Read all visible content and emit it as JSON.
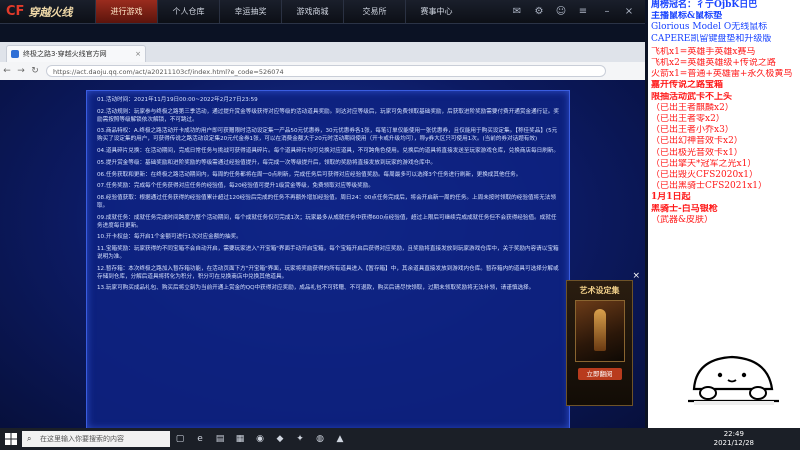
{
  "launcher": {
    "logo_text": "穿越火线",
    "tabs": [
      {
        "label": "进行游戏",
        "active": true
      },
      {
        "label": "个人仓库",
        "active": false
      },
      {
        "label": "幸运抽奖",
        "active": false
      },
      {
        "label": "游戏商城",
        "active": false
      },
      {
        "label": "交易所",
        "active": false
      },
      {
        "label": "赛事中心",
        "active": false
      }
    ]
  },
  "browser": {
    "tab_title": "终极之路3·穿越火线官方网",
    "url": "https://act.daoju.qq.com/act/a20211103cf/index.html?e_code=526074"
  },
  "notice": {
    "paragraphs": [
      "01.活动时间：2021年11月19日00:00~2022年2月27日23:59",
      "02.活动规则：玩家参与终极之路第三季活动，通过提升赏金等级获得对应等级的活动道具奖励。到达对应等级后，玩家可免费领取基础奖励，后获取进阶奖励需要付费开通赏金通行证。奖励需按照等级解锁依次解锁，不可跳过。",
      "03.商品特权：A.终极之路活动开卡成功的用户即可获赠限时活动设定集一产品50元优惠券，30元优惠券各1张，每笔订单仅能使用一张优惠券，且仅能用于购买设定集。【称佳奖品】(5元购买了设定集的用户，可获得传说之路活动设定集20元代金券1张，可以在消费金额大于20元时活动期间使用（开卡或升级均可），称y券大区只可使用1次。(当前的券对话题有效)",
      "04.道具碎片兑换：在活动期间，完成日常任务与挑战可获得道具碎片。每个道具碎片均可兑换对应道具，不可跨角色使用。兑换后的道具将直接发送至玩家游戏仓库，兑换商店每日刷新。",
      "05.提升赏金等级：基础奖励和进阶奖励的等级需通过经验值提升，每完成一次等级提升后，领取的奖励将直接发放到玩家的游戏仓库中。",
      "06.任务获取和更新：在终极之路活动期间内，每周的任务都将在周一0点刷新，完成任务后可获得对应经验值奖励。每周最多可以选择3个任务进行刷新，更换成其他任务。",
      "07.任务奖励：完成每个任务获得对应任务的经验值，每20经验值可提升1级赏金等级，免费领取对应等级奖励。",
      "08.经验值获取：根据通过任务获得的经验值累计超过120经验后完成的任务不再额外增加经验值。周日24：00点任务完成后，将会开启新一周的任务。上周未按时领取的经验值将无法领取。",
      "09.成就任务：成就任务完成时间跨度为整个活动期间，每个成就任务仅可完成1次；玩家最多从成就任务中获得600点经验值，超过上限后可继续完成成就任务但不会获得经验值。成就任务进度每日更新。",
      "10.开卡权益：每开启1个金额可进行1次对应金额的抽奖。",
      "11.宝箱奖励：玩家获得的不同宝箱不会自动开启，需要玩家进入\"开宝箱\"界面手动开启宝箱，每个宝箱开启后获得对应奖励，且奖励将直接发放到玩家游戏仓库中，关于奖励内容请以宝箱说明为准。",
      "12.暂存箱：本次终极之路加入暂存箱功能，在活动页面下方\"开宝箱\"界面，玩家将奖励获得的所有道具进入【暂存箱】中，其余道具直接发放到游戏内仓库。暂存箱内的道具可选择分解或存储到仓库，分解后道具将转化为积分，积分可在兑换商店中兑换其他道具。",
      "13.玩家可购买成品礼包、购买后将立刻为当前开通上赏金的QQ中获得对应奖励，成品礼包不可转赠、不可退款，购买后请尽快领取，过期未领取奖励将无法补领，请谨慎选择。"
    ]
  },
  "side_ad": {
    "heading": "艺术设定集",
    "cta": "立即翻阅",
    "close": "×"
  },
  "overlay": {
    "lines": [
      {
        "text": "周榜冠名：彳亍OjbK日巴",
        "color": "blue"
      },
      {
        "text": "主播鼠标&鼠标垫",
        "color": "blue"
      },
      {
        "text": "Glorious Model O无线鼠标",
        "color": "blue"
      },
      {
        "text": "CAPERE凯留键盘垫和升级版",
        "color": "blue"
      },
      {
        "text": "飞机x1=英雄手英雄x赛马",
        "color": "red"
      },
      {
        "text": "飞机x2=英雄英雄级+传说之路",
        "color": "red"
      },
      {
        "text": "火箭x1=普通+英雄雷+永久极黄鸟",
        "color": "red"
      },
      {
        "text": "嘉开传说之路宝箱",
        "color": "red"
      },
      {
        "text": "限抽活动武卡不上头",
        "color": "red"
      },
      {
        "text": "（已出王者麒麟x2）",
        "color": "red"
      },
      {
        "text": "（已出王者零x2）",
        "color": "red"
      },
      {
        "text": "（已出王者小乔x3）",
        "color": "red"
      },
      {
        "text": "（已出幻神音效卡x2）",
        "color": "red"
      },
      {
        "text": "（已出极光音效卡x1）",
        "color": "red"
      },
      {
        "text": "（已出擎天*冠军之光x1）",
        "color": "red"
      },
      {
        "text": "（已出毁灭CFS2020x1）",
        "color": "red"
      },
      {
        "text": "（已出黑骑士CFS2021x1）",
        "color": "red"
      },
      {
        "text": "1月1日起",
        "color": "red"
      },
      {
        "text": "黑骑士-白马银枪",
        "color": "red"
      },
      {
        "text": "（武器&皮肤）",
        "color": "red"
      }
    ]
  },
  "taskbar": {
    "search_placeholder": "在这里输入你要搜索的内容",
    "time": "22:49",
    "date": "2021/12/28"
  },
  "colors": {
    "launcher_active": "#9a2c1e",
    "notice_bg": "#0e2282",
    "overlay_red": "#ff1a1a",
    "overlay_blue": "#1a44ff"
  }
}
